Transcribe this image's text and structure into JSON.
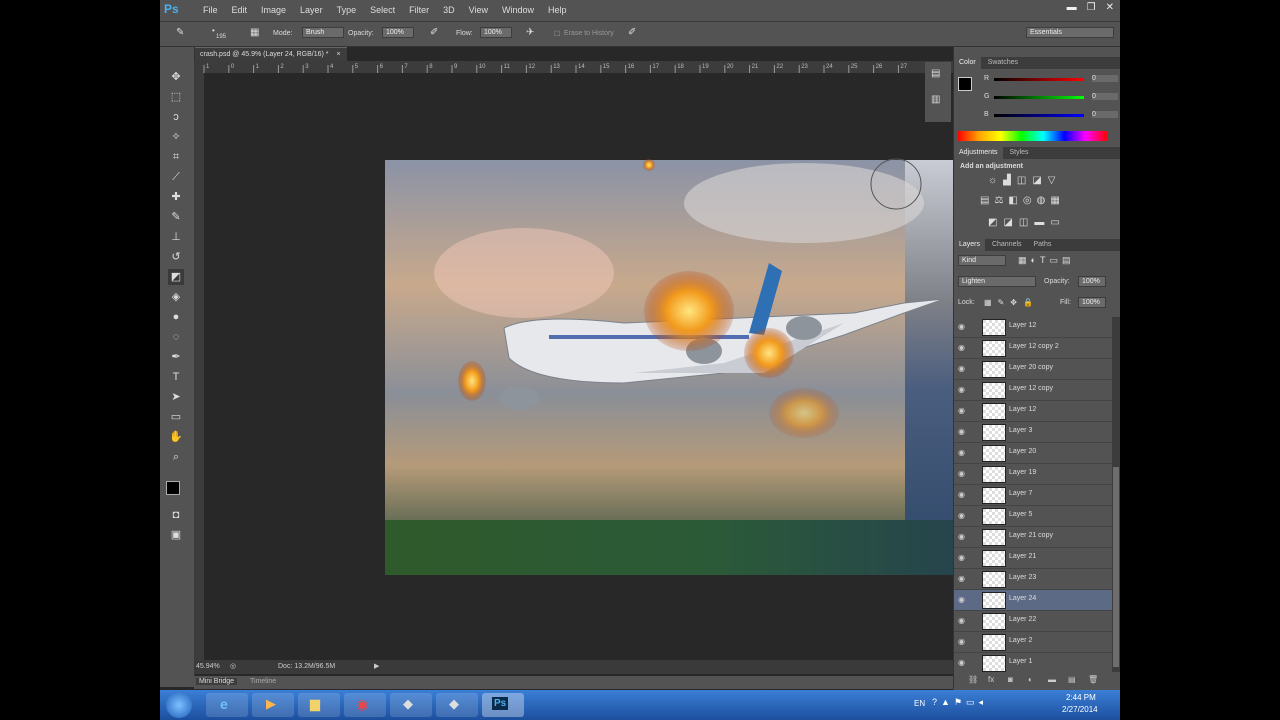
{
  "app": {
    "logo": "Ps"
  },
  "menubar": {
    "items": [
      "File",
      "Edit",
      "Image",
      "Layer",
      "Type",
      "Select",
      "Filter",
      "3D",
      "View",
      "Window",
      "Help"
    ]
  },
  "options": {
    "brush_size": "195",
    "mode_label": "Mode:",
    "mode_value": "Brush",
    "opacity_label": "Opacity:",
    "opacity_value": "100%",
    "flow_label": "Flow:",
    "flow_value": "100%",
    "erase_history": "Erase to History",
    "workspace": "Essentials"
  },
  "document": {
    "tab_title": "crash.psd @ 45.9% (Layer 24, RGB/16) *",
    "zoom": "45.94%",
    "doc_size": "Doc: 13.2M/96.5M"
  },
  "ruler": {
    "ticks": [
      "1",
      "0",
      "1",
      "2",
      "3",
      "4",
      "5",
      "6",
      "7",
      "8",
      "9",
      "10",
      "11",
      "12",
      "13",
      "14",
      "15",
      "16",
      "17",
      "18",
      "19",
      "20",
      "21",
      "22",
      "23",
      "24",
      "25",
      "26",
      "27"
    ]
  },
  "color_panel": {
    "tabs": [
      "Color",
      "Swatches"
    ],
    "r_label": "R",
    "r_value": "0",
    "g_label": "G",
    "g_value": "0",
    "b_label": "B",
    "b_value": "0"
  },
  "adjustments_panel": {
    "tabs": [
      "Adjustments",
      "Styles"
    ],
    "title": "Add an adjustment"
  },
  "layers_panel": {
    "tabs": [
      "Layers",
      "Channels",
      "Paths"
    ],
    "filter": "Kind",
    "blend_mode": "Lighten",
    "opacity_label": "Opacity:",
    "opacity_value": "100%",
    "lock_label": "Lock:",
    "fill_label": "Fill:",
    "fill_value": "100%",
    "layers": [
      {
        "name": "Layer 12"
      },
      {
        "name": "Layer 12 copy 2"
      },
      {
        "name": "Layer 20 copy"
      },
      {
        "name": "Layer 12 copy"
      },
      {
        "name": "Layer 12"
      },
      {
        "name": "Layer 3"
      },
      {
        "name": "Layer 20"
      },
      {
        "name": "Layer 19"
      },
      {
        "name": "Layer 7"
      },
      {
        "name": "Layer 5"
      },
      {
        "name": "Layer 21 copy"
      },
      {
        "name": "Layer 21"
      },
      {
        "name": "Layer 23"
      },
      {
        "name": "Layer 24",
        "selected": true
      },
      {
        "name": "Layer 22"
      },
      {
        "name": "Layer 2"
      },
      {
        "name": "Layer 1"
      }
    ]
  },
  "bottom_tabs": [
    "Mini Bridge",
    "Timeline"
  ],
  "taskbar": {
    "lang": "EN",
    "time": "2:44 PM",
    "date": "2/27/2014"
  }
}
